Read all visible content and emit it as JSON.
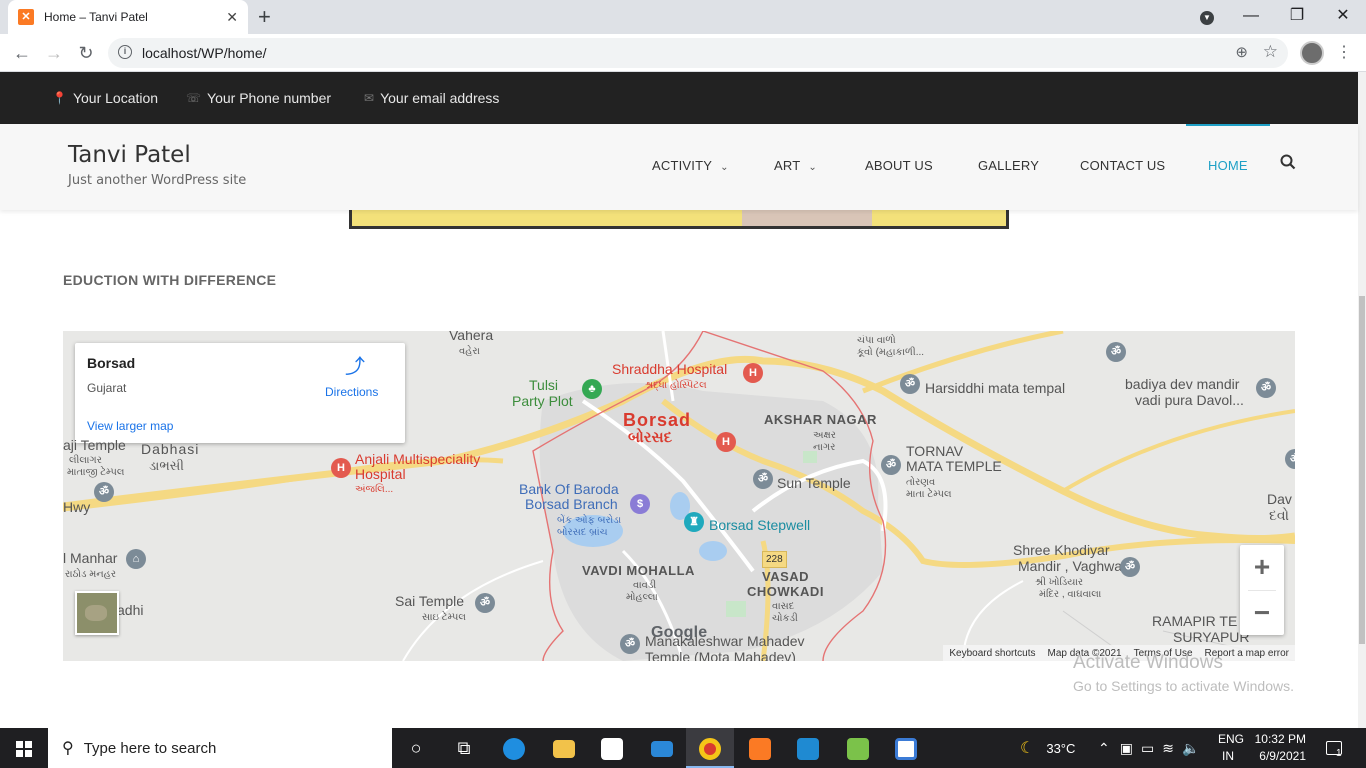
{
  "browser": {
    "tab_title": "Home – Tanvi Patel",
    "url": "localhost/WP/home/"
  },
  "topbar": {
    "location": "Your Location",
    "phone": "Your Phone number",
    "email": "Your email address"
  },
  "site": {
    "title": "Tanvi Patel",
    "tagline": "Just another WordPress site"
  },
  "nav": [
    {
      "label": "ACTIVITY",
      "has_dropdown": true
    },
    {
      "label": "ART",
      "has_dropdown": true
    },
    {
      "label": "ABOUT US",
      "has_dropdown": false
    },
    {
      "label": "GALLERY",
      "has_dropdown": false
    },
    {
      "label": "CONTACT US",
      "has_dropdown": false
    },
    {
      "label": "HOME",
      "has_dropdown": false,
      "active": true
    }
  ],
  "section": {
    "title": "EDUCTION WITH DIFFERENCE"
  },
  "map": {
    "place": "Borsad",
    "region": "Gujarat",
    "view_larger": "View larger map",
    "directions": "Directions",
    "labels": {
      "vahera": "Vahera",
      "vahera_g": "વહેરા",
      "shraddha": "Shraddha Hospital",
      "shraddha_g": "શ્રદ્ધા હોસ્પિટલ",
      "chapa": "ચંપા વાળો",
      "kuvo": "કૂવો (મહાકાળી...",
      "harsiddhi": "Harsiddhi mata tempal",
      "badiya1": "badiya dev mandir",
      "badiya2": "vadi pura Davol...",
      "tulsi1": "Tulsi",
      "tulsi2": "Party Plot",
      "borsad": "Borsad",
      "borsad_g": "બોરસદ",
      "akshar": "AKSHAR NAGAR",
      "akshar_g1": "અક્ષર",
      "akshar_g2": "નાગર",
      "lili1": "aji Temple",
      "lili2": "લીલાગર",
      "lili3": "માતાજી ટેમ્પલ",
      "dabhasi": "Dabhasi",
      "dabhasi_g": "ડાભસી",
      "anjali1": "Anjali Multispeciality",
      "anjali2": "Hospital",
      "anjali_g": "અંજલિ...",
      "tornav1": "TORNAV",
      "tornav2": "MATA TEMPLE",
      "tornav_g1": "તોરણવ",
      "tornav_g2": "માતા ટેમ્પલ",
      "sun": "Sun Temple",
      "bob1": "Bank Of Baroda",
      "bob2": "Borsad Branch",
      "bob_g1": "બેંક ઓફ બરોડા",
      "bob_g2": "બોરસદ બ્રાંચ",
      "stepwell": "Borsad Stepwell",
      "hwy": "Hwy",
      "dav": "Dav",
      "dav_g": "દવો",
      "manhar": "l Manhar",
      "manhar_g": "રાઠોડ મનહર",
      "adhi": "adhi",
      "vavdi": "VAVDI MOHALLA",
      "vavdi_g1": "વાવડી",
      "vavdi_g2": "મોહલ્લા",
      "road": "228",
      "vasad1": "VASAD",
      "vasad2": "CHOWKADI",
      "vasad_g1": "વાસદ",
      "vasad_g2": "ચોકડી",
      "khodiyar1": "Shree Khodiyar",
      "khodiyar2": "Mandir , Vaghwala",
      "khodiyar_g1": "શ્રી ખોડિયાર",
      "khodiyar_g2": "મંદિર , વાઘવાલા",
      "sai": "Sai Temple",
      "sai_g": "સાઇ ટેમ્પલ",
      "ramapir1": "RAMAPIR TE",
      "ramapir2": "SURYAPUR",
      "manakal1": "Manakaleshwar Mahadev",
      "manakal2": "Temple (Mota Mahadev)"
    },
    "google": "Google",
    "attribution": [
      "Keyboard shortcuts",
      "Map data ©2021",
      "Terms of Use",
      "Report a map error"
    ]
  },
  "activate": {
    "line1": "Activate Windows",
    "line2": "Go to Settings to activate Windows."
  },
  "taskbar": {
    "search_placeholder": "Type here to search",
    "temperature": "33°C",
    "lang1": "ENG",
    "lang2": "IN",
    "time": "10:32 PM",
    "date": "6/9/2021",
    "notifications": "1"
  }
}
